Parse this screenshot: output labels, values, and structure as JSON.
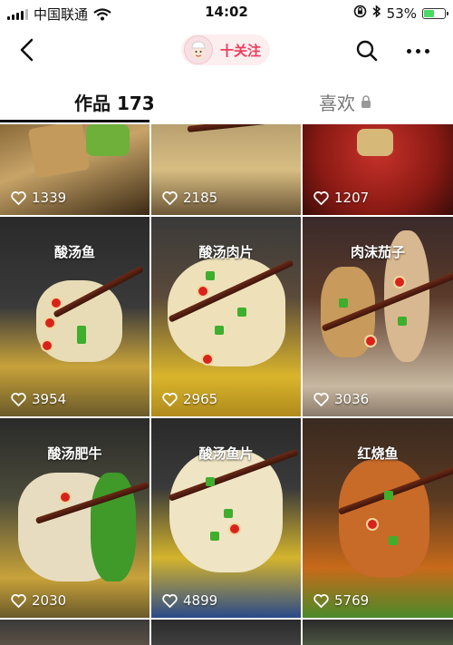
{
  "status_bar": {
    "carrier": "中国联通",
    "time": "14:02",
    "battery_pct": "53%",
    "battery_level": 0.53
  },
  "nav": {
    "back_icon": "chevron-left-icon",
    "follow_label": "十关注",
    "search_icon": "search-icon",
    "more_icon": "more-dots-icon"
  },
  "tabs": {
    "works_label": "作品 173",
    "likes_label": "喜欢",
    "likes_icon": "lock-icon"
  },
  "grid": {
    "items": [
      {
        "caption": "",
        "likes": "1339"
      },
      {
        "caption": "",
        "likes": "2185"
      },
      {
        "caption": "",
        "likes": "1207"
      },
      {
        "caption": "酸汤鱼",
        "likes": "3954"
      },
      {
        "caption": "酸汤肉片",
        "likes": "2965"
      },
      {
        "caption": "肉沫茄子",
        "likes": "3036"
      },
      {
        "caption": "酸汤肥牛",
        "likes": "2030"
      },
      {
        "caption": "酸汤鱼片",
        "likes": "4899"
      },
      {
        "caption": "红烧鱼",
        "likes": "5769"
      }
    ]
  },
  "colors": {
    "accent": "#ee3b5b",
    "battery_green": "#4cd964"
  }
}
